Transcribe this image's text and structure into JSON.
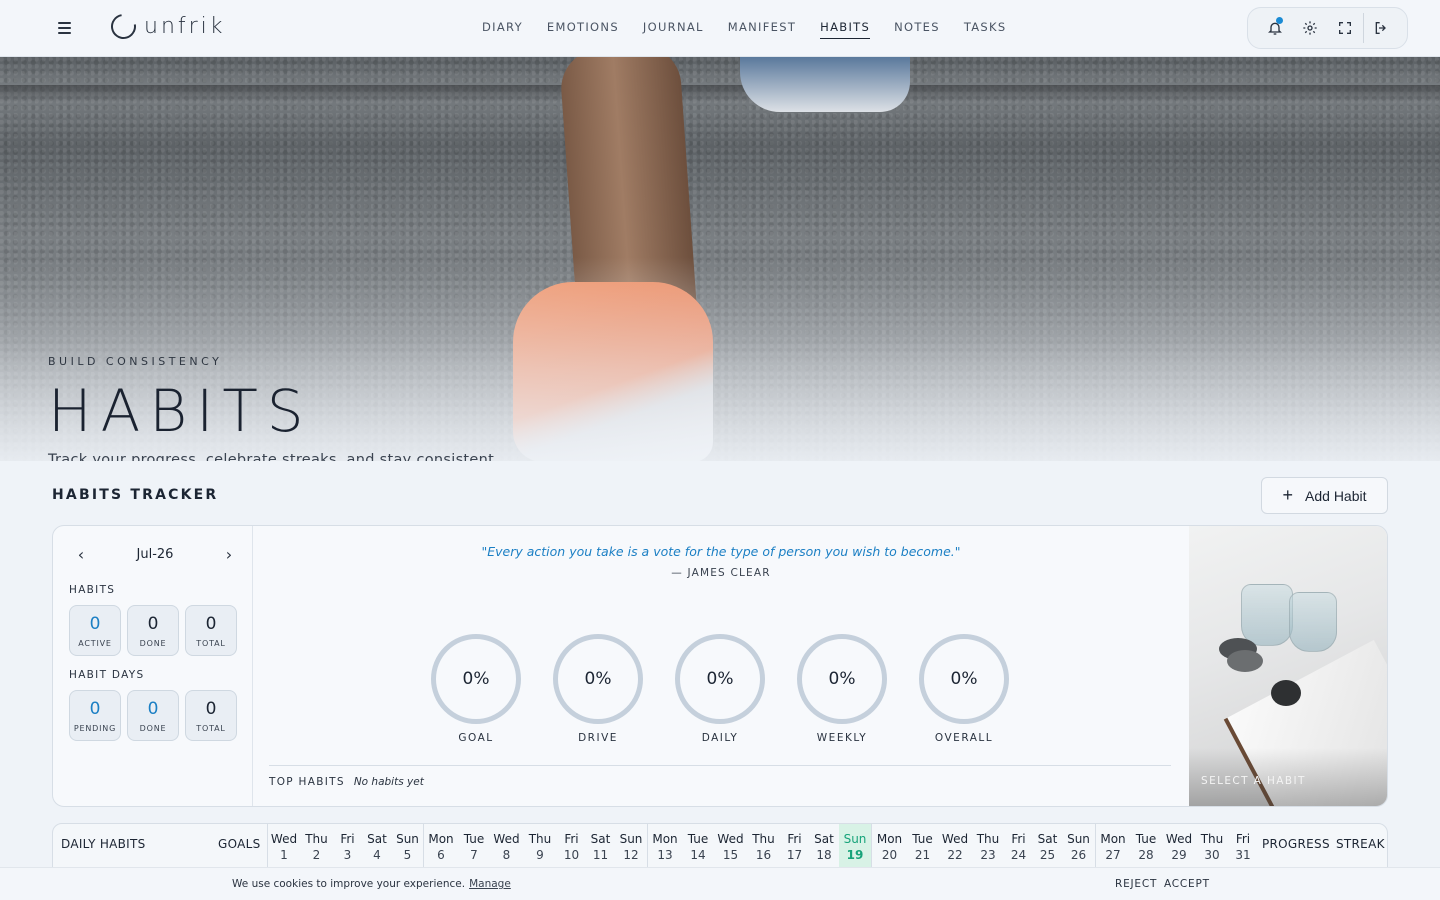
{
  "app": {
    "name": "unfrik"
  },
  "nav": {
    "items": [
      {
        "label": "DIARY"
      },
      {
        "label": "EMOTIONS"
      },
      {
        "label": "JOURNAL"
      },
      {
        "label": "MANIFEST"
      },
      {
        "label": "HABITS",
        "active": true
      },
      {
        "label": "NOTES"
      },
      {
        "label": "TASKS"
      }
    ],
    "icons": [
      "bell-icon",
      "gear-icon",
      "fullscreen-icon",
      "logout-icon"
    ]
  },
  "hero": {
    "eyebrow": "BUILD CONSISTENCY",
    "title": "HABITS",
    "subtitle": "Track your progress, celebrate streaks, and stay consistent"
  },
  "tracker": {
    "title": "HABITS TRACKER",
    "add_label": "Add Habit",
    "month": "Jul-26",
    "habits_label": "HABITS",
    "habits_stats": [
      {
        "value": "0",
        "label": "ACTIVE"
      },
      {
        "value": "0",
        "label": "DONE"
      },
      {
        "value": "0",
        "label": "TOTAL"
      }
    ],
    "days_label": "HABIT DAYS",
    "days_stats": [
      {
        "value": "0",
        "label": "PENDING"
      },
      {
        "value": "0",
        "label": "DONE"
      },
      {
        "value": "0",
        "label": "TOTAL"
      }
    ],
    "quote": "\"Every action you take is a vote for the type of person you wish to become.\"",
    "quote_author": "— JAMES CLEAR",
    "rings": [
      {
        "value": "0%",
        "label": "GOAL"
      },
      {
        "value": "0%",
        "label": "DRIVE"
      },
      {
        "value": "0%",
        "label": "DAILY"
      },
      {
        "value": "0%",
        "label": "WEEKLY"
      },
      {
        "value": "0%",
        "label": "OVERALL"
      }
    ],
    "top_habits_label": "TOP HABITS",
    "top_habits_empty": "No habits yet",
    "select_label": "SELECT A HABIT"
  },
  "table": {
    "daily_label": "DAILY HABITS",
    "goals_label": "GOALS",
    "progress_label": "PROGRESS",
    "streak_label": "STREAK",
    "days": [
      {
        "d": "Wed",
        "n": "1"
      },
      {
        "d": "Thu",
        "n": "2"
      },
      {
        "d": "Fri",
        "n": "3"
      },
      {
        "d": "Sat",
        "n": "4"
      },
      {
        "d": "Sun",
        "n": "5"
      },
      {
        "d": "Mon",
        "n": "6"
      },
      {
        "d": "Tue",
        "n": "7"
      },
      {
        "d": "Wed",
        "n": "8"
      },
      {
        "d": "Thu",
        "n": "9"
      },
      {
        "d": "Fri",
        "n": "10"
      },
      {
        "d": "Sat",
        "n": "11"
      },
      {
        "d": "Sun",
        "n": "12"
      },
      {
        "d": "Mon",
        "n": "13"
      },
      {
        "d": "Tue",
        "n": "14"
      },
      {
        "d": "Wed",
        "n": "15"
      },
      {
        "d": "Thu",
        "n": "16"
      },
      {
        "d": "Fri",
        "n": "17"
      },
      {
        "d": "Sat",
        "n": "18"
      },
      {
        "d": "Sun",
        "n": "19",
        "today": true
      },
      {
        "d": "Mon",
        "n": "20"
      },
      {
        "d": "Tue",
        "n": "21"
      },
      {
        "d": "Wed",
        "n": "22"
      },
      {
        "d": "Thu",
        "n": "23"
      },
      {
        "d": "Fri",
        "n": "24"
      },
      {
        "d": "Sat",
        "n": "25"
      },
      {
        "d": "Sun",
        "n": "26"
      },
      {
        "d": "Mon",
        "n": "27"
      },
      {
        "d": "Tue",
        "n": "28"
      },
      {
        "d": "Wed",
        "n": "29"
      },
      {
        "d": "Thu",
        "n": "30"
      },
      {
        "d": "Fri",
        "n": "31"
      }
    ]
  },
  "cookie": {
    "text": "We use cookies to improve your experience.",
    "manage": "Manage",
    "reject": "REJECT",
    "accept": "ACCEPT"
  },
  "colors": {
    "accent": "#1b7fc4",
    "today": "#d8f2e6",
    "today_text": "#17a37a",
    "notification_dot": "#1b8bd4"
  }
}
